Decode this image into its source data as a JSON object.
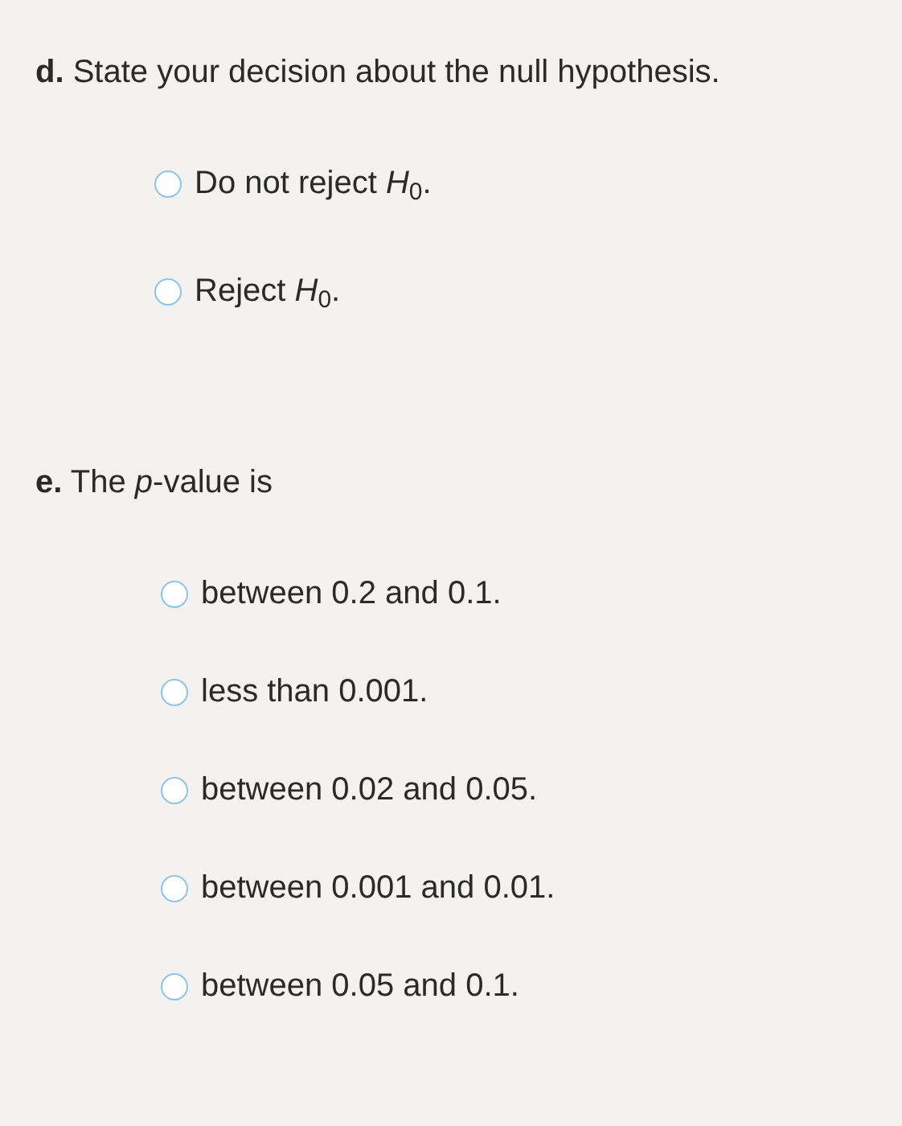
{
  "questions": [
    {
      "label": "d.",
      "prompt": "State your decision about the null hypothesis.",
      "options": [
        {
          "text": "Do not reject *H*$_{0}$.",
          "selected": false
        },
        {
          "text": "Reject *H*$_{0}$.",
          "selected": false
        }
      ]
    },
    {
      "label": "e.",
      "prompt": "The *p*-value is",
      "options": [
        {
          "text": "between 0.2 and 0.1.",
          "selected": false
        },
        {
          "text": "less than 0.001.",
          "selected": false
        },
        {
          "text": "between 0.02 and 0.05.",
          "selected": false
        },
        {
          "text": "between 0.001 and 0.01.",
          "selected": false
        },
        {
          "text": "between 0.05 and 0.1.",
          "selected": false
        }
      ]
    }
  ]
}
